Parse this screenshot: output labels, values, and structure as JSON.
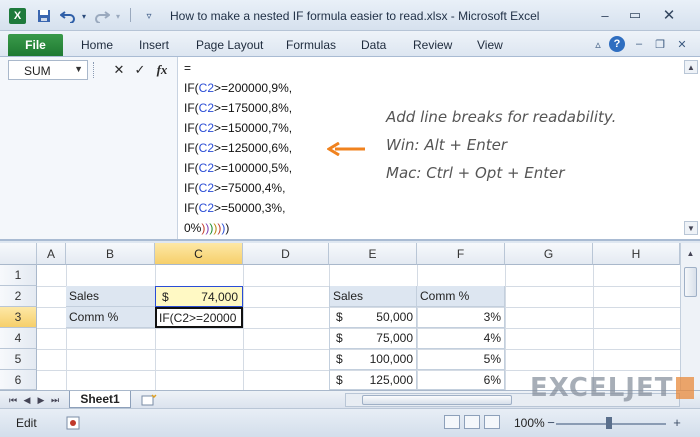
{
  "window": {
    "title": "How to make a nested IF formula easier to read.xlsx - Microsoft Excel",
    "app_logo": "X",
    "qat": {
      "save_icon": "save-icon",
      "undo_icon": "undo-icon",
      "redo_icon": "redo-icon"
    }
  },
  "ribbon": {
    "file_label": "File",
    "tabs": [
      "Home",
      "Insert",
      "Page Layout",
      "Formulas",
      "Data",
      "Review",
      "View"
    ]
  },
  "formula_bar": {
    "name_box": "SUM",
    "fx_label": "fx",
    "lines": [
      {
        "a": "IF(",
        "ref": "C2",
        "b": ">=200000,9%,"
      },
      {
        "a": "IF(",
        "ref": "C2",
        "b": ">=175000,8%,"
      },
      {
        "a": "IF(",
        "ref": "C2",
        "b": ">=150000,7%,"
      },
      {
        "a": "IF(",
        "ref": "C2",
        "b": ">=125000,6%,"
      },
      {
        "a": "IF(",
        "ref": "C2",
        "b": ">=100000,5%,"
      },
      {
        "a": "IF(",
        "ref": "C2",
        "b": ">=75000,4%,"
      },
      {
        "a": "IF(",
        "ref": "C2",
        "b": ">=50000,3%,"
      }
    ],
    "first_line": "=",
    "last_line_prefix": "0%",
    "closing_parens": [
      ")",
      ")",
      ")",
      ")",
      ")",
      ")",
      ")"
    ]
  },
  "annotation": {
    "line1": "Add line breaks for readability.",
    "line2": "Win:  Alt + Enter",
    "line3": "Mac: Ctrl + Opt + Enter",
    "accent_color": "#f0821e"
  },
  "grid": {
    "columns": [
      "A",
      "B",
      "C",
      "D",
      "E",
      "F",
      "G",
      "H"
    ],
    "rows": [
      "1",
      "2",
      "3",
      "4",
      "5",
      "6"
    ],
    "selected_column": "C",
    "selected_row": "3",
    "labels": {
      "sales": "Sales",
      "comm": "Comm %"
    },
    "sales_value": {
      "currency": "$",
      "amount": "74,000"
    },
    "editing_text": "IF(C2>=20000",
    "table": {
      "headers": [
        "Sales",
        "Comm %"
      ],
      "rows": [
        {
          "currency": "$",
          "amount": "50,000",
          "pct": "3%"
        },
        {
          "currency": "$",
          "amount": "75,000",
          "pct": "4%"
        },
        {
          "currency": "$",
          "amount": "100,000",
          "pct": "5%"
        },
        {
          "currency": "$",
          "amount": "125,000",
          "pct": "6%"
        }
      ]
    }
  },
  "sheets": {
    "active": "Sheet1"
  },
  "status": {
    "mode": "Edit",
    "zoom": "100%"
  },
  "watermark": "EXCELJET"
}
